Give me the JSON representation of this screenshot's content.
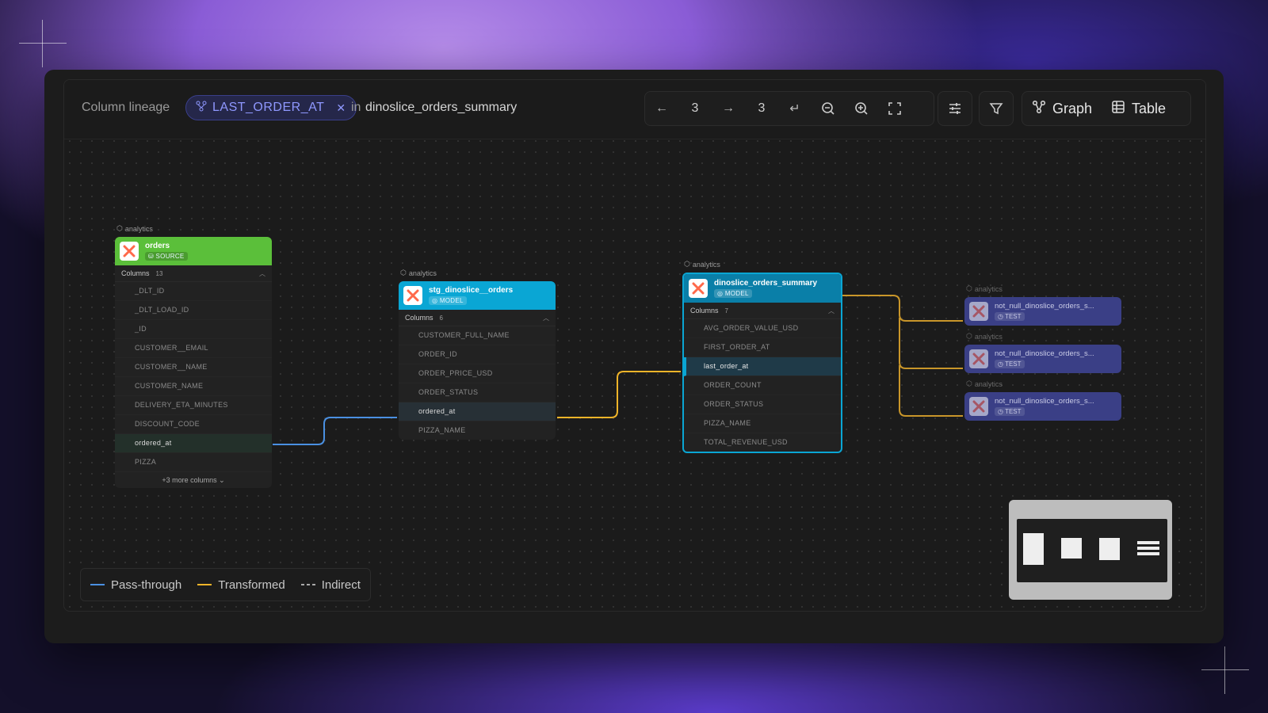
{
  "toolbar": {
    "title": "Column lineage",
    "chip_label": "LAST_ORDER_AT",
    "in_label": "in",
    "model_name": "dinoslice_orders_summary",
    "nav_upstream_depth": "3",
    "nav_downstream_depth": "3",
    "view_graph_label": "Graph",
    "view_table_label": "Table"
  },
  "nodes": [
    {
      "schema": "analytics",
      "name": "orders",
      "badge": "SOURCE",
      "columns_label": "Columns",
      "columns_count": "13",
      "columns": [
        "_DLT_ID",
        "_DLT_LOAD_ID",
        "_ID",
        "CUSTOMER__EMAIL",
        "CUSTOMER__NAME",
        "CUSTOMER_NAME",
        "DELIVERY_ETA_MINUTES",
        "DISCOUNT_CODE",
        "ordered_at",
        "PIZZA"
      ],
      "more": "+3 more columns"
    },
    {
      "schema": "analytics",
      "name": "stg_dinoslice__orders",
      "badge": "MODEL",
      "columns_label": "Columns",
      "columns_count": "6",
      "columns": [
        "CUSTOMER_FULL_NAME",
        "ORDER_ID",
        "ORDER_PRICE_USD",
        "ORDER_STATUS",
        "ordered_at",
        "PIZZA_NAME"
      ]
    },
    {
      "schema": "analytics",
      "name": "dinoslice_orders_summary",
      "badge": "MODEL",
      "columns_label": "Columns",
      "columns_count": "7",
      "columns": [
        "AVG_ORDER_VALUE_USD",
        "FIRST_ORDER_AT",
        "last_order_at",
        "ORDER_COUNT",
        "ORDER_STATUS",
        "PIZZA_NAME",
        "TOTAL_REVENUE_USD"
      ]
    }
  ],
  "tests": [
    {
      "schema": "analytics",
      "name": "not_null_dinoslice_orders_s...",
      "badge": "TEST"
    },
    {
      "schema": "analytics",
      "name": "not_null_dinoslice_orders_s...",
      "badge": "TEST"
    },
    {
      "schema": "analytics",
      "name": "not_null_dinoslice_orders_s...",
      "badge": "TEST"
    }
  ],
  "legend": {
    "pass_through": "Pass-through",
    "transformed": "Transformed",
    "indirect": "Indirect"
  },
  "colors": {
    "source": "#5bbf3a",
    "model": "#0aa6d4",
    "test": "#3a3f86",
    "pass_through": "#4a90e2",
    "transformed": "#f0b429"
  }
}
